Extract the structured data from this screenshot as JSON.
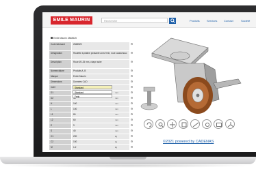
{
  "brand": {
    "logo_text": "EMILE MAURIN",
    "logo_color": "#d8262d",
    "accent": "#1d5fa8"
  },
  "header": {
    "search_placeholder": "Recherche",
    "nav": [
      "Produits",
      "Services",
      "Contact",
      "Société"
    ]
  },
  "product": {
    "breadcrumb": "Emile Maurin 2848525",
    "rows": [
      {
        "label": "Code fabricant",
        "value": "2848525"
      },
      {
        "label": "Désignation",
        "value": "Roulette à platine pivotante avec frein, roue caoutchouc"
      },
      {
        "label": "Description",
        "value": "Roue Ø 125 mm, chape acier"
      },
      {
        "label": "Nomenclature",
        "value": "Produits A, B"
      },
      {
        "label": "Marque",
        "value": "Emile Maurin"
      },
      {
        "label": "Dimensions",
        "value": "Données CAO"
      },
      {
        "label": "CAO",
        "value": "Standard"
      },
      {
        "label": "D1",
        "value": "125",
        "unit": "mm"
      },
      {
        "label": "D2",
        "value": "38",
        "unit": "mm"
      },
      {
        "label": "H",
        "value": "160",
        "unit": "mm"
      },
      {
        "label": "L",
        "value": "100",
        "unit": "mm"
      },
      {
        "label": "L1",
        "value": "80",
        "unit": "mm"
      },
      {
        "label": "L2",
        "value": "60",
        "unit": "mm"
      },
      {
        "label": "E",
        "value": "9",
        "unit": "mm"
      },
      {
        "label": "S",
        "value": "40",
        "unit": "mm"
      },
      {
        "label": "C1",
        "value": "200",
        "unit": "kg"
      },
      {
        "label": "C2",
        "value": "150",
        "unit": "kg"
      },
      {
        "label": "M",
        "value": "1.2",
        "unit": "kg"
      }
    ],
    "dropdown_selected": "Standard",
    "dropdown_options": [
      "Standard",
      "Frein"
    ]
  },
  "viewer": {
    "powered_by": "©2021 powered by CADENAS",
    "tools": [
      "rotate-icon",
      "zoom-icon",
      "pan-icon",
      "cube-icon",
      "measure-icon",
      "settings-icon",
      "screen-icon",
      "axes-icon"
    ]
  }
}
